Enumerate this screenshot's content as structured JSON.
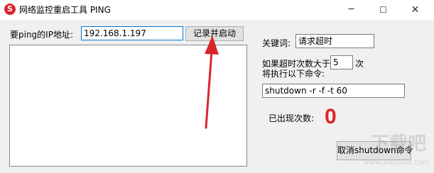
{
  "window": {
    "title": "网络监控重启工具 PING",
    "minimize_glyph": "─",
    "maximize_glyph": "☐",
    "close_glyph": "✕"
  },
  "ping": {
    "ip_label": "要ping的IP地址:",
    "ip_value": "192.168.1.197",
    "record_button": "记录并启动"
  },
  "settings": {
    "keyword_label": "关键词:",
    "keyword_value": "请求超时",
    "timeout_prefix": "如果超时次数大于",
    "timeout_value": "5",
    "timeout_suffix": "次",
    "execute_label": "将执行以下命令:",
    "command_value": "shutdown -r -f -t 60",
    "occurrences_label": "已出现次数:",
    "occurrences_value": "0",
    "cancel_button": "取消shutdown命令"
  },
  "watermark": {
    "site": "下载吧",
    "url": "www.xiazaiba.com"
  },
  "colors": {
    "arrow": "#d9262c",
    "count": "#e02424",
    "focus_border": "#0078d7"
  }
}
